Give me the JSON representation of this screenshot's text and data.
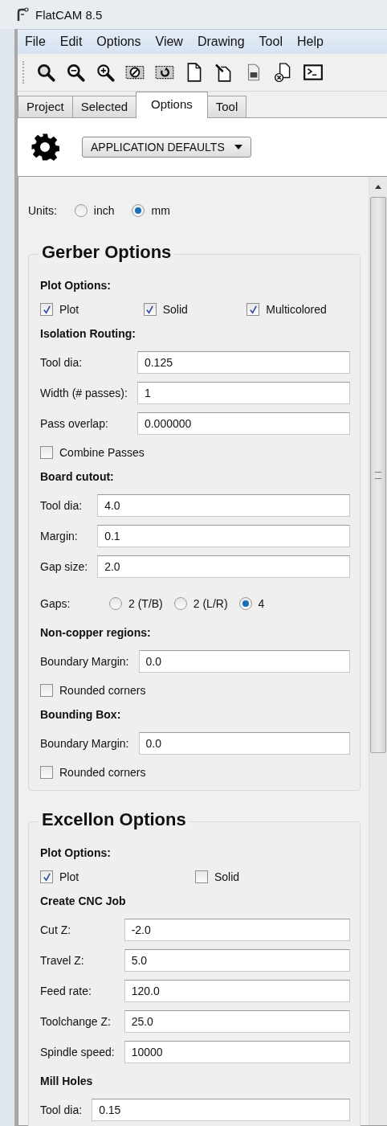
{
  "window": {
    "title": "FlatCAM 8.5"
  },
  "menu": [
    "File",
    "Edit",
    "Options",
    "View",
    "Drawing",
    "Tool",
    "Help"
  ],
  "tabs": [
    {
      "label": "Project",
      "selected": false
    },
    {
      "label": "Selected",
      "selected": false
    },
    {
      "label": "Options",
      "selected": true
    },
    {
      "label": "Tool",
      "selected": false
    }
  ],
  "preset": {
    "value": "APPLICATION DEFAULTS"
  },
  "units": {
    "label": "Units:",
    "options": [
      {
        "label": "inch",
        "selected": false
      },
      {
        "label": "mm",
        "selected": true
      }
    ]
  },
  "sections": [
    {
      "title": "Gerber Options",
      "items": [
        {
          "kind": "subheading",
          "text": "Plot Options:"
        },
        {
          "kind": "checks",
          "options": [
            {
              "label": "Plot",
              "checked": true
            },
            {
              "label": "Solid",
              "checked": true
            },
            {
              "label": "Multicolored",
              "checked": true
            }
          ]
        },
        {
          "kind": "subheading",
          "text": "Isolation Routing:"
        },
        {
          "kind": "fields",
          "rows": [
            {
              "label": "Tool dia:",
              "value": "0.125"
            },
            {
              "label": "Width (# passes):",
              "value": "1"
            },
            {
              "label": "Pass overlap:",
              "value": "0.000000"
            }
          ]
        },
        {
          "kind": "checkbox",
          "label": "Combine Passes",
          "checked": false
        },
        {
          "kind": "subheading",
          "text": "Board cutout:"
        },
        {
          "kind": "fields",
          "rows": [
            {
              "label": "Tool dia:",
              "value": "4.0"
            },
            {
              "label": "Margin:",
              "value": "0.1"
            },
            {
              "label": "Gap size:",
              "value": "2.0"
            }
          ]
        },
        {
          "kind": "radios",
          "label": "Gaps:",
          "options": [
            {
              "label": "2 (T/B)",
              "selected": false
            },
            {
              "label": "2 (L/R)",
              "selected": false
            },
            {
              "label": "4",
              "selected": true
            }
          ]
        },
        {
          "kind": "subheading",
          "text": "Non-copper regions:"
        },
        {
          "kind": "fields",
          "rows": [
            {
              "label": "Boundary Margin:",
              "value": "0.0"
            }
          ]
        },
        {
          "kind": "checkbox",
          "label": "Rounded corners",
          "checked": false
        },
        {
          "kind": "subheading",
          "text": "Bounding Box:"
        },
        {
          "kind": "fields",
          "rows": [
            {
              "label": "Boundary Margin:",
              "value": "0.0"
            }
          ]
        },
        {
          "kind": "checkbox",
          "label": "Rounded corners",
          "checked": false
        }
      ]
    },
    {
      "title": "Excellon Options",
      "items": [
        {
          "kind": "subheading",
          "text": "Plot Options:"
        },
        {
          "kind": "checks",
          "options": [
            {
              "label": "Plot",
              "checked": true
            },
            {
              "label": "Solid",
              "checked": false
            }
          ]
        },
        {
          "kind": "subheading",
          "text": "Create CNC Job"
        },
        {
          "kind": "fields",
          "rows": [
            {
              "label": "Cut Z:",
              "value": "-2.0"
            },
            {
              "label": "Travel Z:",
              "value": "5.0"
            },
            {
              "label": "Feed rate:",
              "value": "120.0"
            },
            {
              "label": "Toolchange Z:",
              "value": "25.0"
            },
            {
              "label": "Spindle speed:",
              "value": "10000"
            }
          ]
        },
        {
          "kind": "subheading",
          "text": "Mill Holes"
        },
        {
          "kind": "fields",
          "rows": [
            {
              "label": "Tool dia:",
              "value": "0.15"
            }
          ]
        }
      ]
    }
  ]
}
